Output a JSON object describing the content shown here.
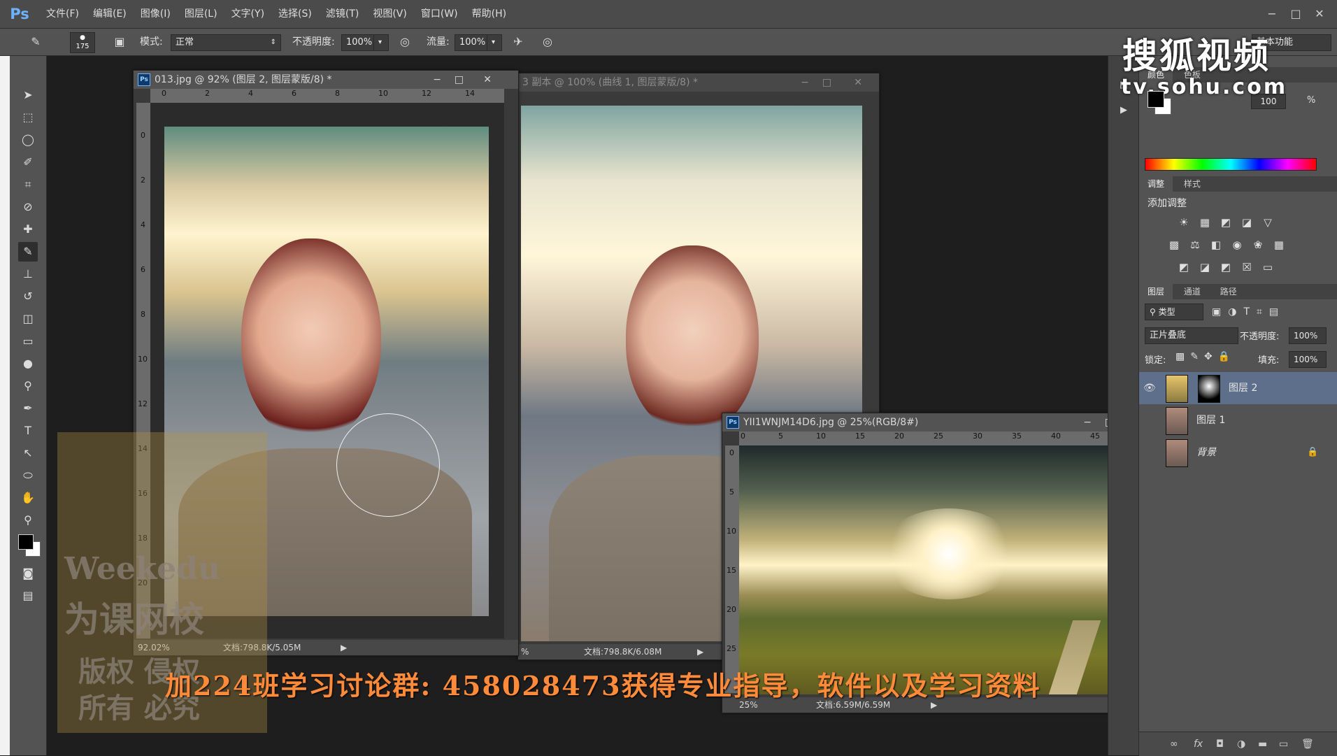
{
  "menubar": {
    "logo": "Ps",
    "items": [
      "文件(F)",
      "编辑(E)",
      "图像(I)",
      "图层(L)",
      "文字(Y)",
      "选择(S)",
      "滤镜(T)",
      "视图(V)",
      "窗口(W)",
      "帮助(H)"
    ],
    "win_min": "−",
    "win_max": "□",
    "win_close": "✕"
  },
  "options": {
    "brush_size": "175",
    "mode_label": "模式:",
    "mode_value": "正常",
    "opacity_label": "不透明度:",
    "opacity_value": "100%",
    "flow_label": "流量:",
    "flow_value": "100%",
    "workspace": "基本功能"
  },
  "docs": {
    "doc1": {
      "title": "013.jpg @ 92% (图层 2, 图层蒙版/8) *",
      "ruler": [
        "0",
        "2",
        "4",
        "6",
        "8",
        "10",
        "12",
        "14"
      ],
      "vruler": [
        "0",
        "2",
        "4",
        "6",
        "8",
        "10",
        "12",
        "14",
        "16",
        "18",
        "20"
      ],
      "zoom": "92.02%",
      "doc_size": "文档:798.8K/5.05M"
    },
    "doc2": {
      "title": "3 副本 @ 100% (曲线 1, 图层蒙版/8) *",
      "zoom": "%",
      "doc_size": "文档:798.8K/6.08M"
    },
    "doc3": {
      "title": "YII1WNJM14D6.jpg @ 25%(RGB/8#)",
      "ruler": [
        "0",
        "5",
        "10",
        "15",
        "20",
        "25",
        "30",
        "35",
        "40",
        "45",
        "5"
      ],
      "vruler": [
        "0",
        "5",
        "10",
        "15",
        "20",
        "25"
      ],
      "zoom": "25%",
      "doc_size": "文档:6.59M/6.59M"
    }
  },
  "panels": {
    "color_tabs": [
      "颜色",
      "色板"
    ],
    "color_value": "100",
    "color_unit": "%",
    "adj_tabs": [
      "调整",
      "样式"
    ],
    "adj_title": "添加调整",
    "layer_tabs": [
      "图层",
      "通道",
      "路径"
    ],
    "kind_label": "类型",
    "blend_mode": "正片叠底",
    "opacity_label": "不透明度:",
    "opacity_value": "100%",
    "lock_label": "锁定:",
    "fill_label": "填充:",
    "fill_value": "100%",
    "layers": [
      {
        "name": "图层 2",
        "selected": true
      },
      {
        "name": "图层 1",
        "selected": false
      },
      {
        "name": "背景",
        "selected": false
      }
    ],
    "bottom_icons": [
      "link-icon",
      "fx-icon",
      "mask-icon",
      "adjustment-icon",
      "folder-icon",
      "new-layer-icon",
      "trash-icon"
    ]
  },
  "overlays": {
    "sohu_logo": "搜狐视频",
    "sohu_url": "tv.sohu.com",
    "caption": "加224班学习讨论群:   458028473获得专业指导，软件以及学习资料",
    "watermark_line1": "Weekedu",
    "watermark_line2": "为课网校",
    "watermark_line3": "版权  侵权",
    "watermark_line4": "所有  必究"
  },
  "colors": {
    "accent": "#6db2ff",
    "layer_selected": "#5e6f8c",
    "caption": "#ff8a3a"
  }
}
